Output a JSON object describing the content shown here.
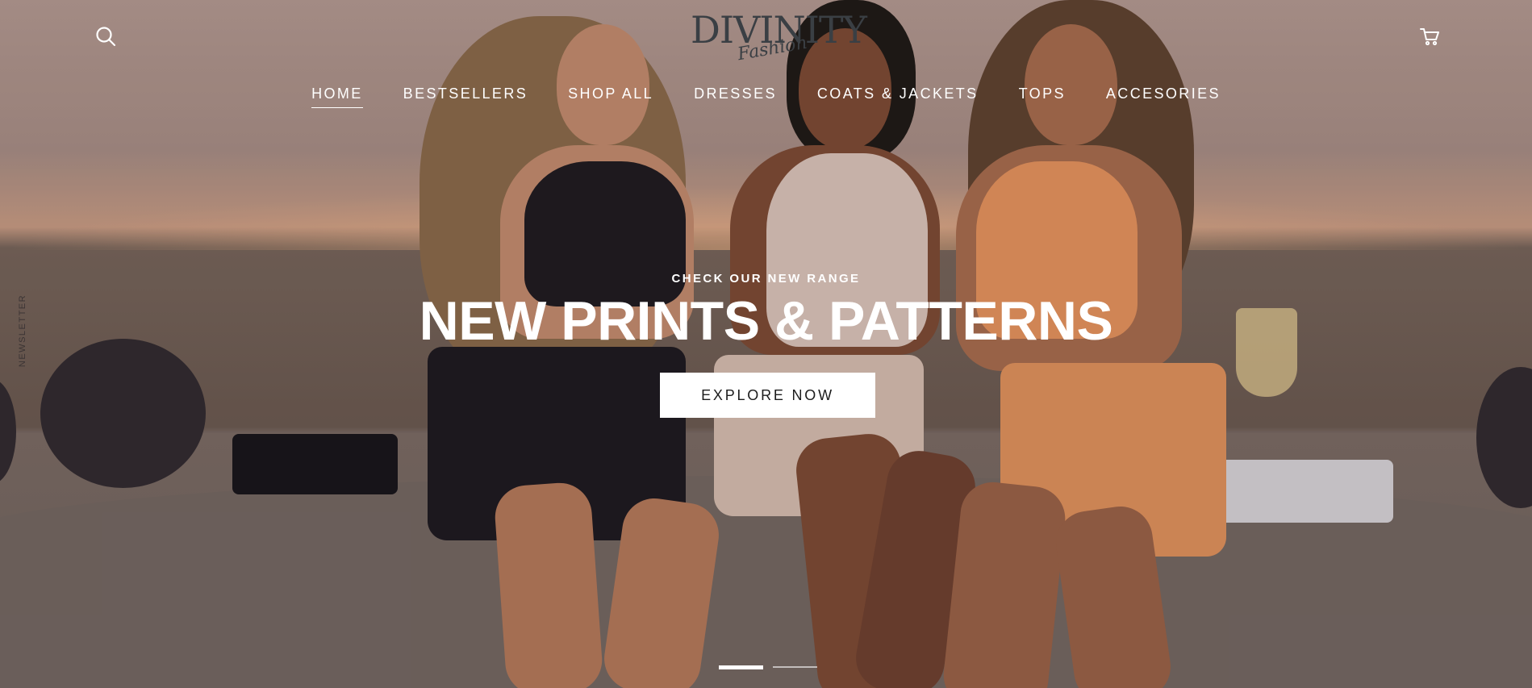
{
  "header": {
    "logo_main": "DIVINITY",
    "logo_sub": "Fashion"
  },
  "nav": {
    "items": [
      "HOME",
      "BESTSELLERS",
      "SHOP ALL",
      "DRESSES",
      "COATS & JACKETS",
      "TOPS",
      "ACCESORIES"
    ],
    "active_index": 0
  },
  "sidebar": {
    "newsletter_label": "NEWSLETTER"
  },
  "hero": {
    "eyebrow": "CHECK OUR NEW RANGE",
    "headline": "NEW PRINTS & PATTERNS",
    "cta_label": "EXPLORE NOW"
  },
  "slider": {
    "slide_count": 2,
    "active_slide": 1
  },
  "icons": {
    "search": "search-icon",
    "cart": "cart-icon"
  },
  "colors": {
    "text_light": "#ffffff",
    "logo": "#3a3f44",
    "button_bg": "#ffffff",
    "button_text": "#1c1c1c"
  }
}
